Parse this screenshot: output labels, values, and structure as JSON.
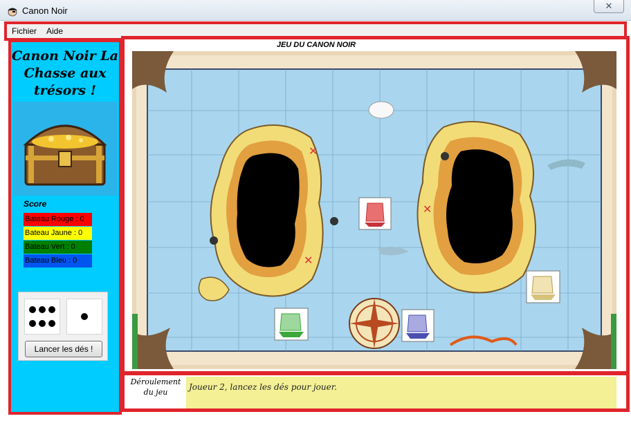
{
  "window": {
    "title": "Canon Noir",
    "close_label": "✕"
  },
  "menu": {
    "items": [
      "Fichier",
      "Aide"
    ]
  },
  "sidebar": {
    "game_title": "Canon Noir La Chasse aux trésors !",
    "score_label": "Score",
    "scores": [
      {
        "label": "Bateau Rouge : 0",
        "bg": "#ff0000",
        "fg": "#000000"
      },
      {
        "label": "Bateau Jaune : 0",
        "bg": "#ffff00",
        "fg": "#000000"
      },
      {
        "label": "Bateau Vert : 0",
        "bg": "#008000",
        "fg": "#000000"
      },
      {
        "label": "Bateau Bleu : 0",
        "bg": "#0055ee",
        "fg": "#000000"
      }
    ],
    "dice": [
      6,
      1
    ],
    "roll_button": "Lancer les dés !"
  },
  "board": {
    "heading": "JEU DU CANON NOIR",
    "ships": [
      {
        "color": "red",
        "hex": "#c8323a"
      },
      {
        "color": "yellow",
        "hex": "#d8c27a"
      },
      {
        "color": "green",
        "hex": "#3aa83a"
      },
      {
        "color": "blue",
        "hex": "#4a4fb0"
      }
    ]
  },
  "info": {
    "label": "Déroulement du jeu",
    "message": "Joueur 2, lancez les dés pour jouer."
  },
  "colors": {
    "accent_border": "#e0242b",
    "sidebar_bg": "#00ccff",
    "sea": "#a9d6ee",
    "message_bg": "#f3f095"
  }
}
